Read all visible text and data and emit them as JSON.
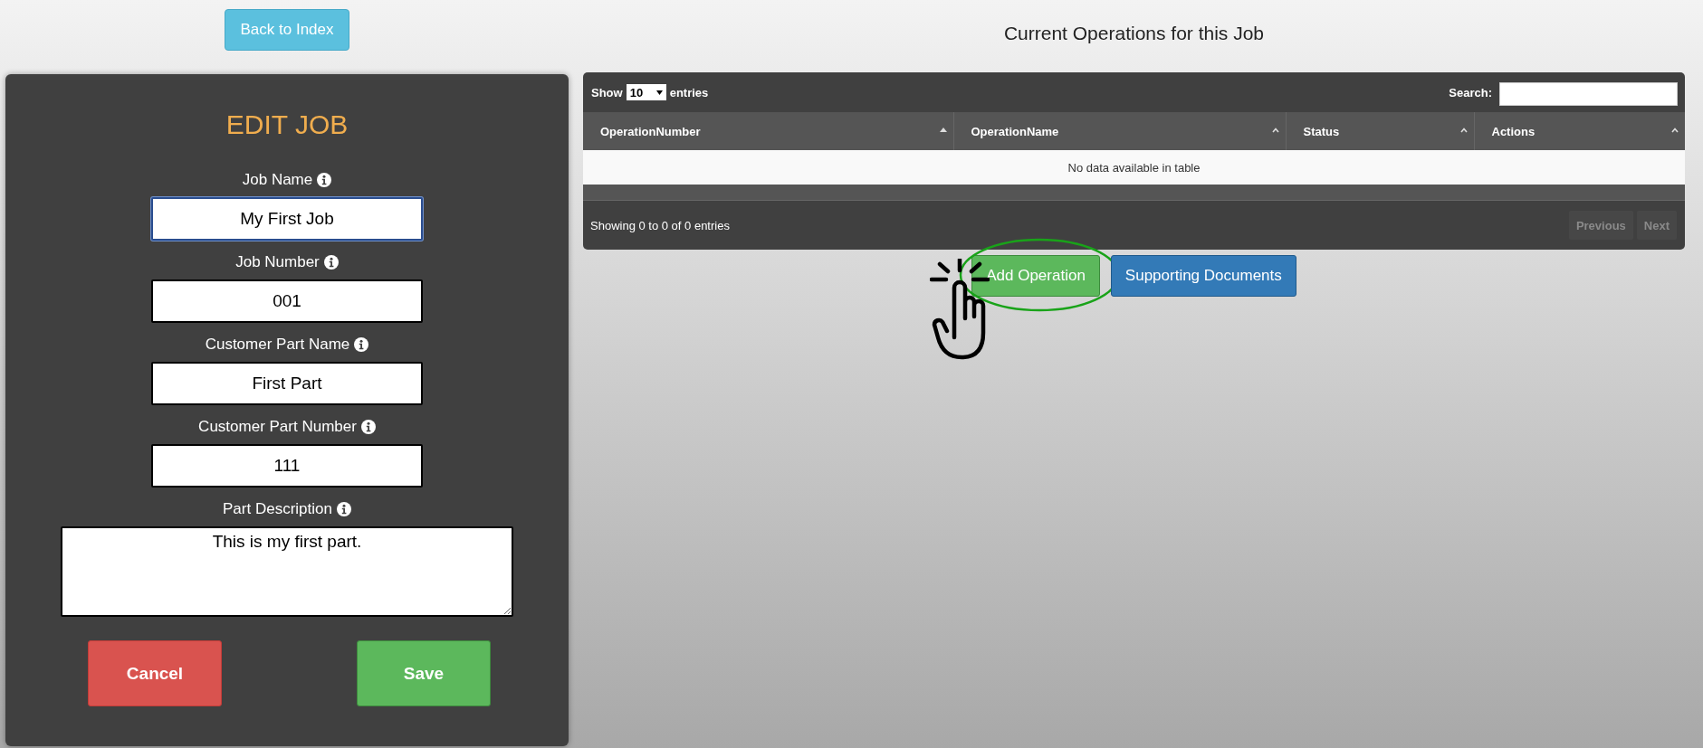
{
  "back_button": {
    "label": "Back to Index"
  },
  "form": {
    "title": "EDIT JOB",
    "fields": [
      {
        "kind": "input",
        "label": "Job Name",
        "value": "My First Job",
        "focused": true
      },
      {
        "kind": "input",
        "label": "Job Number",
        "value": "001",
        "focused": false
      },
      {
        "kind": "input",
        "label": "Customer Part Name",
        "value": "First Part",
        "focused": false
      },
      {
        "kind": "input",
        "label": "Customer Part Number",
        "value": "111",
        "focused": false
      },
      {
        "kind": "textarea",
        "label": "Part Description",
        "value": "This is my first part.",
        "focused": false
      }
    ],
    "buttons": [
      {
        "kind": "danger",
        "label": "Cancel"
      },
      {
        "kind": "success",
        "label": "Save"
      }
    ]
  },
  "operations": {
    "heading": "Current Operations for this Job",
    "length_menu": {
      "before": "Show",
      "value": "10",
      "after": "entries"
    },
    "search": {
      "label": "Search:"
    },
    "columns": [
      {
        "label": "OperationNumber",
        "sorted": true
      },
      {
        "label": "OperationName",
        "sorted": false
      },
      {
        "label": "Status",
        "sorted": false
      },
      {
        "label": "Actions",
        "sorted": false
      }
    ],
    "empty_message": "No data available in table",
    "info": "Showing 0 to 0 of 0 entries",
    "pagination": [
      {
        "label": "Previous",
        "disabled": true
      },
      {
        "label": "Next",
        "disabled": true
      }
    ],
    "actions": [
      {
        "kind": "success",
        "label": "Add Operation",
        "highlighted": true
      },
      {
        "kind": "primary",
        "label": "Supporting Documents",
        "highlighted": false
      }
    ]
  }
}
